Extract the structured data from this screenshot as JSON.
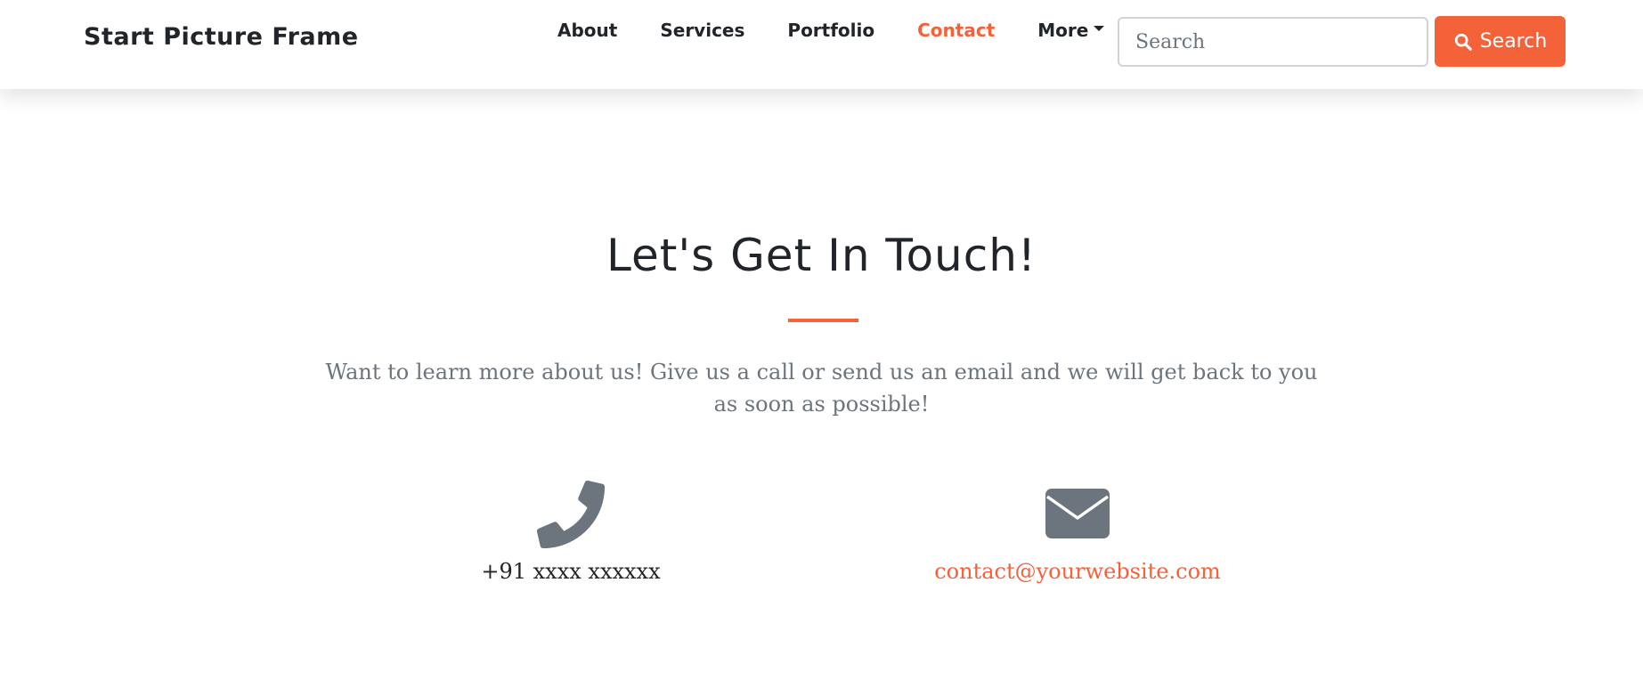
{
  "navbar": {
    "brand": "Start Picture Frame",
    "links": [
      {
        "label": "About"
      },
      {
        "label": "Services"
      },
      {
        "label": "Portfolio"
      },
      {
        "label": "Contact"
      },
      {
        "label": "More"
      }
    ],
    "active_link": "Contact"
  },
  "search": {
    "placeholder": "Search",
    "value": "",
    "button_label": "Search",
    "button_icon": "search-icon"
  },
  "contact": {
    "heading": "Let's Get In Touch!",
    "lead": "Want to learn more about us! Give us a call or send us an email and we will get back to you as soon as possible!",
    "phone": {
      "icon": "phone-icon",
      "text": "+91 xxxx xxxxxx"
    },
    "email": {
      "icon": "envelope-icon",
      "text": "contact@yourwebsite.com"
    }
  },
  "colors": {
    "accent": "#f4623a",
    "text": "#212529",
    "muted": "#6c757d"
  }
}
